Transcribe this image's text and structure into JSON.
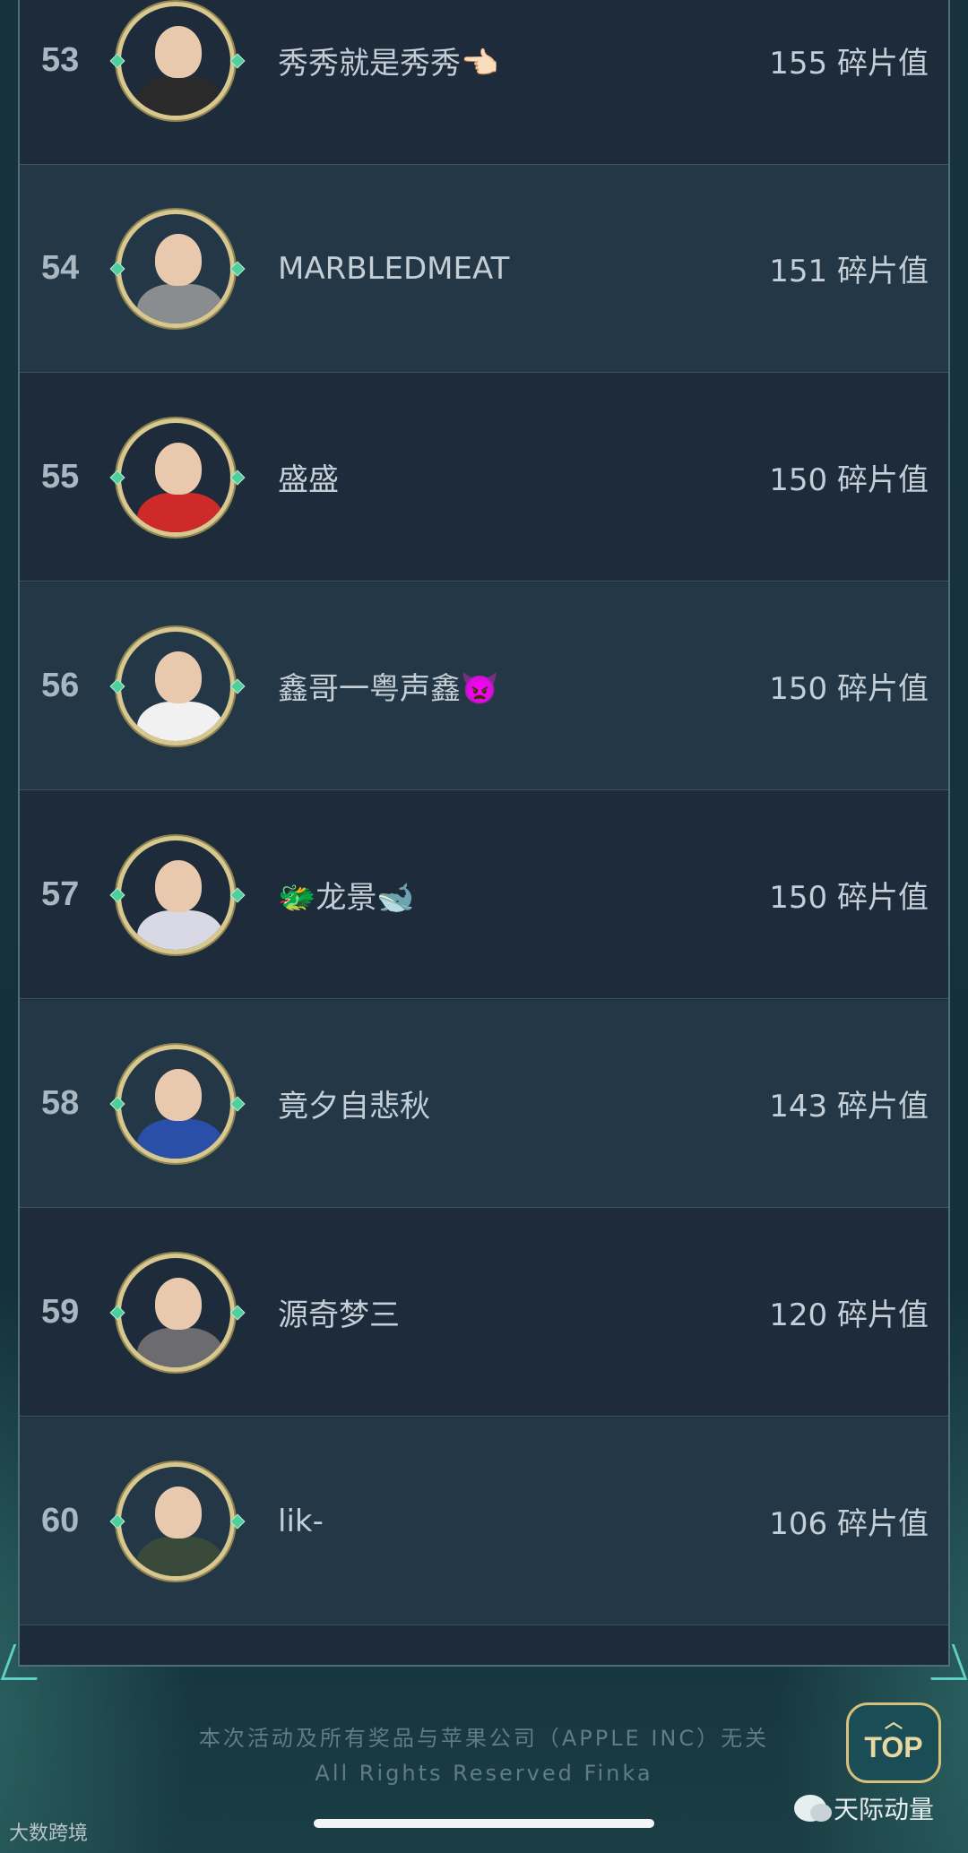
{
  "leaderboard": {
    "rows": [
      {
        "rank": "53",
        "name": "秀秀就是秀秀👈🏻",
        "score": "155 碎片值",
        "shirt": "#2a2a2a"
      },
      {
        "rank": "54",
        "name": "MARBLEDMEAT",
        "score": "151 碎片值",
        "shirt": "#8a8d90"
      },
      {
        "rank": "55",
        "name": "盛盛",
        "score": "150 碎片值",
        "shirt": "#cf2a2a"
      },
      {
        "rank": "56",
        "name": "鑫哥一粤声鑫👿",
        "score": "150 碎片值",
        "shirt": "#f1f1f1"
      },
      {
        "rank": "57",
        "name": "🐲龙景🐋",
        "score": "150 碎片值",
        "shirt": "#d9d9e6"
      },
      {
        "rank": "58",
        "name": "竟夕自悲秋",
        "score": "143 碎片值",
        "shirt": "#2a4fa8"
      },
      {
        "rank": "59",
        "name": "源奇梦三",
        "score": "120 碎片值",
        "shirt": "#6c6c70"
      },
      {
        "rank": "60",
        "name": "lik-",
        "score": "106 碎片值",
        "shirt": "#3a4a3a"
      }
    ]
  },
  "footer": {
    "disclaimer": "本次活动及所有奖品与苹果公司（APPLE INC）无关",
    "rights": "All Rights Reserved Finka"
  },
  "top_button": {
    "label": "TOP",
    "icon": "chevron-up-icon"
  },
  "watermarks": {
    "left": "大数跨境",
    "right": "天际动量"
  },
  "colors": {
    "row_dark": "#1d2b3a",
    "row_light": "#243746",
    "avatar_ring": "#d8c890",
    "accent": "#4ecf9c"
  }
}
